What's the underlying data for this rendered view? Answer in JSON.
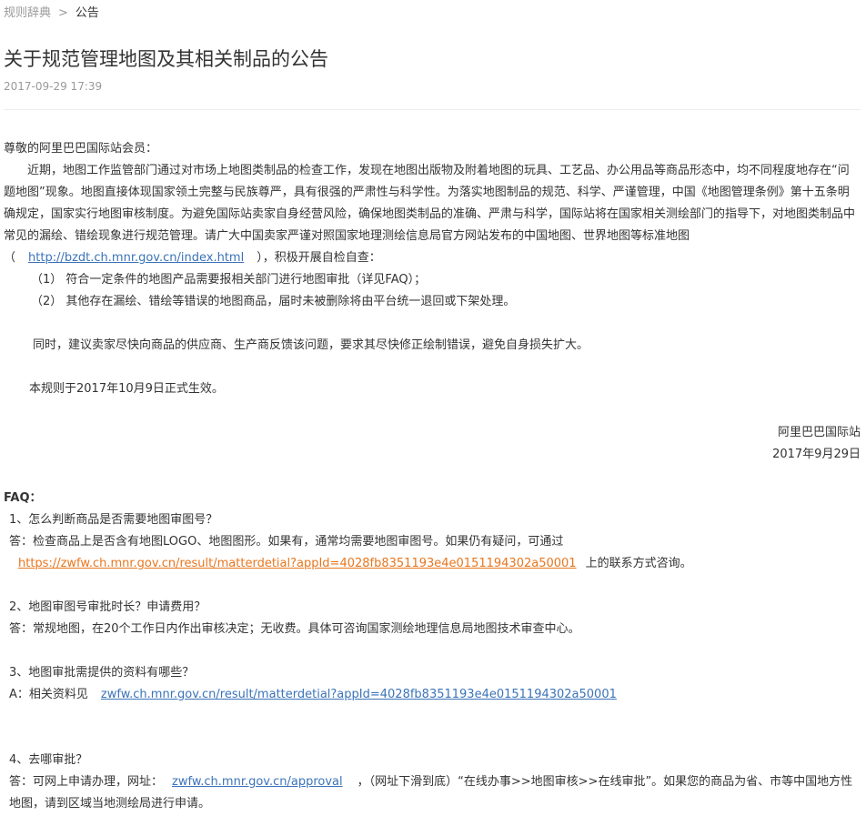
{
  "breadcrumb": {
    "parent": "规则辞典",
    "separator": ">",
    "current": "公告"
  },
  "article": {
    "title": "关于规范管理地图及其相关制品的公告",
    "date": "2017-09-29 17:39"
  },
  "content": {
    "greeting": "尊敬的阿里巴巴国际站会员：",
    "para1_before_link": "近期，地图工作监管部门通过对市场上地图类制品的检查工作，发现在地图出版物及附着地图的玩具、工艺品、办公用品等商品形态中，均不同程度地存在“问题地图”现象。地图直接体现国家领土完整与民族尊严，具有很强的严肃性与科学性。为落实地图制品的规范、科学、严谨管理，中国《地图管理条例》第十五条明确规定，国家实行地图审核制度。为避免国际站卖家自身经营风险，确保地图类制品的准确、严肃与科学，国际站将在国家相关测绘部门的指导下，对地图类制品中常见的漏绘、错绘现象进行规范管理。请广大中国卖家严谨对照国家地理测绘信息局官方网站发布的中国地图、世界地图等标准地图（",
    "para1_link": "http://bzdt.ch.mnr.gov.cn/index.html",
    "para1_after_link": "），积极开展自检自查：",
    "item1": "（1） 符合一定条件的地图产品需要报相关部门进行地图审批（详见FAQ）；",
    "item2": "（2） 其他存在漏绘、错绘等错误的地图商品，届时未被删除将由平台统一退回或下架处理。",
    "para2": "同时，建议卖家尽快向商品的供应商、生产商反馈该问题，要求其尽快修正绘制错误，避免自身损失扩大。",
    "effective": "本规则于2017年10月9日正式生效。",
    "signature": "阿里巴巴国际站",
    "sign_date": "2017年9月29日"
  },
  "faq": {
    "title": "FAQ：",
    "q1": "1、怎么判断商品是否需要地图审图号？",
    "a1_text": "答：检查商品上是否含有地图LOGO、地图图形。如果有，通常均需要地图审图号。如果仍有疑问，可通过",
    "a1_link": "https://zwfw.ch.mnr.gov.cn/result/matterdetial?appId=4028fb8351193e4e0151194302a50001",
    "a1_after": "上的联系方式咨询。",
    "q2": "2、地图审图号审批时长？申请费用？",
    "a2": "答：常规地图，在20个工作日内作出审核决定；无收费。具体可咨询国家测绘地理信息局地图技术审查中心。",
    "q3": "3、地图审批需提供的资料有哪些？",
    "a3_prefix": "A：相关资料见",
    "a3_link": "zwfw.ch.mnr.gov.cn/result/matterdetial?appId=4028fb8351193e4e0151194302a50001",
    "q4": "4、去哪审批？",
    "a4_prefix": "答：可网上申请办理，网址：",
    "a4_link": "zwfw.ch.mnr.gov.cn/approval",
    "a4_after": "，（网址下滑到底）“在线办事>>地图审核>>在线审批”。如果您的商品为省、市等中国地方性地图，请到区域当地测绘局进行申请。"
  },
  "colors": {
    "link_blue": "#3b73b9",
    "link_orange": "#e8761e",
    "muted_gray": "#999999",
    "text": "#333333"
  }
}
